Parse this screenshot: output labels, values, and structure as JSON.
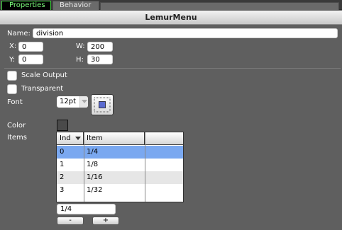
{
  "tabs": [
    {
      "label": "Properties",
      "active": true
    },
    {
      "label": "Behavior",
      "active": false
    }
  ],
  "header": {
    "title": "LemurMenu"
  },
  "name": {
    "label": "Name:",
    "value": "division"
  },
  "geometry": {
    "x_label": "X:",
    "x_value": "0",
    "y_label": "Y:",
    "y_value": "0",
    "w_label": "W:",
    "w_value": "200",
    "h_label": "H:",
    "h_value": "30"
  },
  "options": {
    "scale_output_label": "Scale Output",
    "scale_output_checked": false,
    "transparent_label": "Transparent",
    "transparent_checked": false
  },
  "font": {
    "label": "Font",
    "size": "12pt"
  },
  "color": {
    "label": "Color",
    "swatch": "#4a4a4a"
  },
  "items": {
    "label": "Items",
    "columns": [
      "Ind",
      "Item",
      ""
    ],
    "rows": [
      {
        "ind": "0",
        "item": "1/4",
        "selected": true
      },
      {
        "ind": "1",
        "item": "1/8",
        "selected": false
      },
      {
        "ind": "2",
        "item": "1/16",
        "selected": false
      },
      {
        "ind": "3",
        "item": "1/32",
        "selected": false
      }
    ],
    "edit_value": "1/4",
    "remove_label": "-",
    "add_label": "+"
  }
}
